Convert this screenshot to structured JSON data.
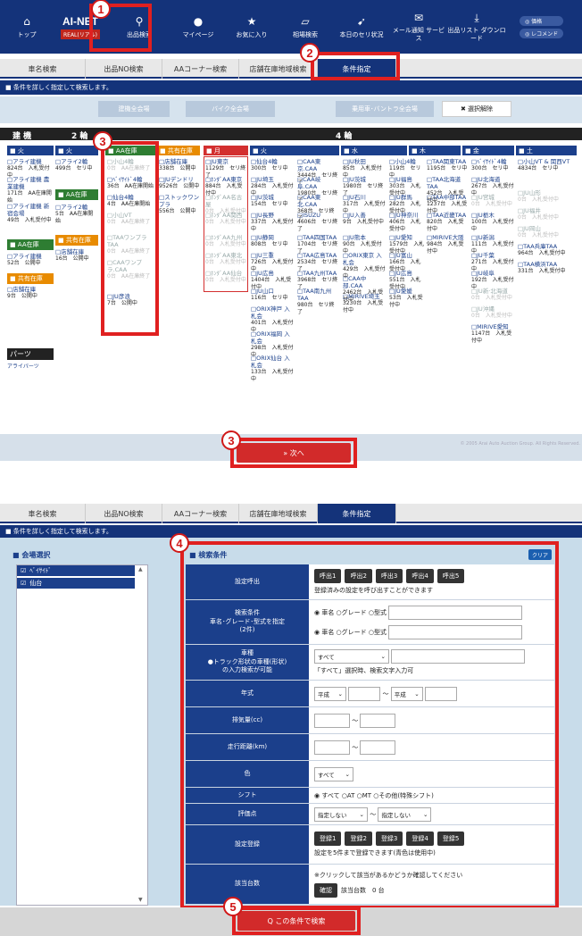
{
  "topnav": {
    "items": [
      "トップ",
      "AI-NET",
      "REAL(リアル)",
      "出品検索",
      "マイページ",
      "お気に入り",
      "相場検索",
      "本日のセリ状況",
      "メール通知\nサービス",
      "出品リスト\nダウンロード"
    ],
    "top_label": "トップ",
    "logo_main": "AI-NET",
    "logo_sub": "REAL(リアル)",
    "search": "出品検索",
    "mypage": "マイページ",
    "favorite": "お気に入り",
    "market": "相場検索",
    "today": "本日のセリ状況",
    "mail": "メール通知 サービス",
    "download": "出品リスト ダウンロード",
    "pill1": "◎ 価格",
    "pill2": "◎ レコメンド"
  },
  "tabs": [
    "車名検索",
    "出品NO検索",
    "AAコーナー検索",
    "店舗在庫地域検索",
    "条件指定"
  ],
  "info": "■ 条件を詳しく指定して検索します。",
  "filter_buttons": {
    "b1": "建機全会場",
    "b2": "バイク全会場",
    "b3": "乗用車･バントラ全会場",
    "clear": "✖ 選択解除"
  },
  "group_headers": {
    "kenki": "建 機",
    "niwa": "2 輪",
    "yonwa": "4 輪"
  },
  "day_headers": {
    "kasui": "■ 火",
    "aa": "■ AA在庫",
    "kyouyu": "■ 共有在庫",
    "getsu": "■ 月",
    "ka": "■ 火",
    "sui": "■ 水",
    "moku": "■ 木",
    "kin": "■ 金",
    "do": "■ 土"
  },
  "col1": {
    "a_name": "□アライ建機",
    "a_cnt": "824台　入札受付中",
    "b_name": "□アライ建機 農業建機",
    "b_cnt": "171台　AA在庫開始",
    "c_name": "□アライ建機 新宿会場",
    "c_cnt": "49台　入札受付中",
    "aa_hdr": "■ AA在庫",
    "d_name": "□アライ建機",
    "d_cnt": "52台　公開中",
    "kyo_hdr": "■ 共有在庫",
    "e_name": "□店舗在庫",
    "e_cnt": "9台　公開中",
    "parts_hdr": "パーツ",
    "parts_item": "アライパーツ"
  },
  "col2": {
    "a_name": "□アライ2輪",
    "a_cnt": "499台　セリ中",
    "aa_hdr": "■ AA在庫",
    "b_name": "□アライ2輪",
    "b_cnt": "5台　AA在庫開始",
    "kyo_hdr": "■ 共有在庫",
    "c_name": "□店舗在庫",
    "c_cnt": "16台　公開中"
  },
  "col3": {
    "a": "□小山4輪",
    "a_c": "0台　AA在庫終了",
    "b": "□ﾍﾞｲｻｲﾄﾞ4輪",
    "b_c": "36台　AA在庫開始",
    "c": "□仙台4輪",
    "c_c": "4台　AA在庫開始",
    "d": "□小山VT",
    "d_c": "0台　AA在庫終了",
    "e": "□TAAワンプラTAA",
    "e_c": "0台　AA在庫終了",
    "f": "□CAAワンプラ.CAA",
    "f_c": "0台　AA在庫終了",
    "g": "□JU彦浪",
    "g_c": "7台　公開中"
  },
  "col4": {
    "a": "□店舗在庫",
    "a_c": "338台　公開中",
    "b": "□JUデンドリ",
    "b_c": "9526台　公開中",
    "c": "□ストックワンプラ",
    "c_c": "556台　公開中"
  },
  "col5": {
    "a": "□JU東京",
    "a_c": "1129台　セリ終了",
    "b": "□ﾎﾝﾀﾞAA東京",
    "b_c": "884台　入札受付中",
    "c": "□ﾎﾝﾀﾞAA名古屋",
    "c_c": "0台　入札受付中",
    "d": "□ﾎﾝﾀﾞAA関西",
    "d_c": "0台　入札受付中",
    "e": "□ﾎﾝﾀﾞAA九州",
    "e_c": "0台　入札受付中",
    "f": "□ﾎﾝﾀﾞAA東北",
    "f_c": "0台　入札受付中",
    "g": "□ﾎﾝﾀﾞAA仙台",
    "g_c": "0台　入札受付中"
  },
  "col6": {
    "a": "□仙台4輪",
    "a_c": "300台　セリ中",
    "b": "□JU埼玉",
    "b_c": "284台　入札受付中",
    "c": "□JU茨城",
    "c_c": "154台　セリ中",
    "d": "□JU長野",
    "d_c": "337台　入札受付中",
    "e": "□JU静岡",
    "e_c": "808台　セリ中",
    "f": "□JU三重",
    "f_c": "726台　入札受付中",
    "g": "□JU広島",
    "g_c": "1404台　入札受付中",
    "h": "□JU山口",
    "h_c": "116台　セリ中",
    "i": "□ORIX神戸 入札会",
    "i_c": "401台　入札受付中",
    "j": "□ORIX福岡 入札会",
    "j_c": "298台　入札受付中",
    "k": "□ORIX仙台 入札会",
    "k_c": "133台　入札受付中"
  },
  "col7": {
    "a": "□CAA東京.CAA",
    "a_c": "3444台　セリ終了",
    "b": "□CAA岐阜.CAA",
    "b_c": "1980台　セリ終了",
    "c": "□CAA東北.CAA",
    "c_c": "368台　セリ終了",
    "d": "□ISUZU",
    "d_c": "4606台　セリ終了",
    "e": "□TAA四国TAA",
    "e_c": "1704台　セリ終了",
    "f": "□TAA広島TAA",
    "f_c": "2534台　セリ終了",
    "g": "□TAA九州TAA",
    "g_c": "3968台　セリ終了",
    "h": "□TAA南九州TAA",
    "h_c": "980台　セリ終了"
  },
  "col8": {
    "a": "□JU秋田",
    "a_c": "85台　入札受付中",
    "b": "□JU茨城",
    "b_c": "1980台　セリ終了",
    "c": "□JU石川",
    "c_c": "317台　入札受付中",
    "d": "□JU入善",
    "d_c": "9台　入札受付中",
    "e": "□JU熊本",
    "e_c": "90台　入札受付中",
    "f": "□ORIX東京 入札会",
    "f_c": "429台　入札受付中",
    "g": "□CAA中部.CAA",
    "g_c": "2462台　入札受付中",
    "h": "□MIRIVE埼玉",
    "h_c": "3230台　入札受付中"
  },
  "col9": {
    "a": "□小山4輪",
    "a_c": "119台　セリ中",
    "b": "□JU福島",
    "b_c": "303台　入札受付中",
    "c": "□JU群馬",
    "c_c": "282台　入札受付中",
    "d": "□JU神奈川",
    "d_c": "406台　入札受付中",
    "e": "□JU愛知",
    "e_c": "1579台　入札受付中",
    "f": "□JU富山",
    "f_c": "166台　入札受付中",
    "g": "□JU広島",
    "g_c": "551台　入札受付中",
    "h": "□JU愛媛",
    "h_c": "53台　入札受付中"
  },
  "col10": {
    "a": "□TAA関東TAA",
    "a_c": "1195台　セリ中",
    "b": "□TAA北海道TAA",
    "b_c": "452台　入札受付中",
    "c": "□TAA中部TAA",
    "c_c": "1237台　入札受付中",
    "d": "□TAA近畿TAA",
    "d_c": "820台　入札受付中",
    "e": "□MIRIVE大阪",
    "e_c": "984台　入札受付中"
  },
  "col11": {
    "a": "□ﾍﾞｲｻｲﾄﾞ4輪",
    "a_c": "300台　セリ中",
    "b": "□JU北海道",
    "b_c": "267台　入札受付中",
    "c": "□JU宮城",
    "c_c": "0台　入札受付中",
    "d": "□JU栃木",
    "d_c": "100台　入札受付中",
    "e": "□JU新潟",
    "e_c": "111台　入札受付中",
    "f": "□JU千葉",
    "f_c": "271台　入札受付中",
    "g": "□JU岐阜",
    "g_c": "192台　入札受付中",
    "h": "□JU新·北海道",
    "h_c": "0台　入札受付中",
    "i": "□JU沖縄",
    "i_c": "0台　入札受付中",
    "j": "□MIRIVE愛知",
    "j_c": "1147台　入札受付中"
  },
  "col12": {
    "a": "□小山VT & 関西VT",
    "a_c": "4834台　セリ中",
    "b": "□JU山形",
    "b_c": "0台　入札受付中",
    "c": "□JU福井",
    "c_c": "0台　入札受付中",
    "d": "□JU岡山",
    "d_c": "0台　入札受付中",
    "e": "□TAA兵庫TAA",
    "e_c": "964台　入札受付中",
    "f": "□TAA横浜TAA",
    "f_c": "331台　入札受付中"
  },
  "footer1": {
    "next": "» 次へ",
    "copyright": "© 2005 Arai Auto Auction Group. All Rights Reserved."
  },
  "venue_panel": {
    "title": "■ 会場選択",
    "items": [
      "ﾍﾞｲｻｲﾄﾞ",
      "仙台"
    ]
  },
  "form": {
    "title": "■ 検索条件",
    "clear": "クリア",
    "r1_label": "設定呼出",
    "r1_btns": [
      "呼出1",
      "呼出2",
      "呼出3",
      "呼出4",
      "呼出5"
    ],
    "r1_note": "登録済みの設定を呼び出すことができます",
    "r2_label": "検索条件\n車名･グレード･型式を指定\n(2件)",
    "r2_radio": "◉ 車名 ○グレード ○型式",
    "r3_label": "車種\n●トラック形状の車種(形状)\nの入力検索が可能",
    "r3_sel": "すべて",
    "r3_note": "「すべて」選択時、検索文字入力可",
    "r4_label": "年式",
    "r4_sel": "平成",
    "r4_sep": "～",
    "r5_label": "排気量(cc)",
    "r6_label": "走行距離(km)",
    "r7_label": "色",
    "r7_sel": "すべて",
    "r8_label": "シフト",
    "r8_val": "◉ すべて ○AT ○MT ○その他(特殊シフト)",
    "r9_label": "評価点",
    "r9_sel": "指定しない",
    "r10_label": "設定登録",
    "r10_btns": [
      "登録1",
      "登録2",
      "登録3",
      "登録4",
      "登録5"
    ],
    "r10_note": "設定を5件まで登録できます(青色は使用中)",
    "r11_label": "該当台数",
    "r11_note": "※クリックして該当があるかどうか確認してください",
    "r11_btn": "確認",
    "r11_count": "該当台数　0 台"
  },
  "search_button": "Q この条件で検索",
  "markers": [
    "1",
    "2",
    "3",
    "3",
    "4",
    "5"
  ]
}
